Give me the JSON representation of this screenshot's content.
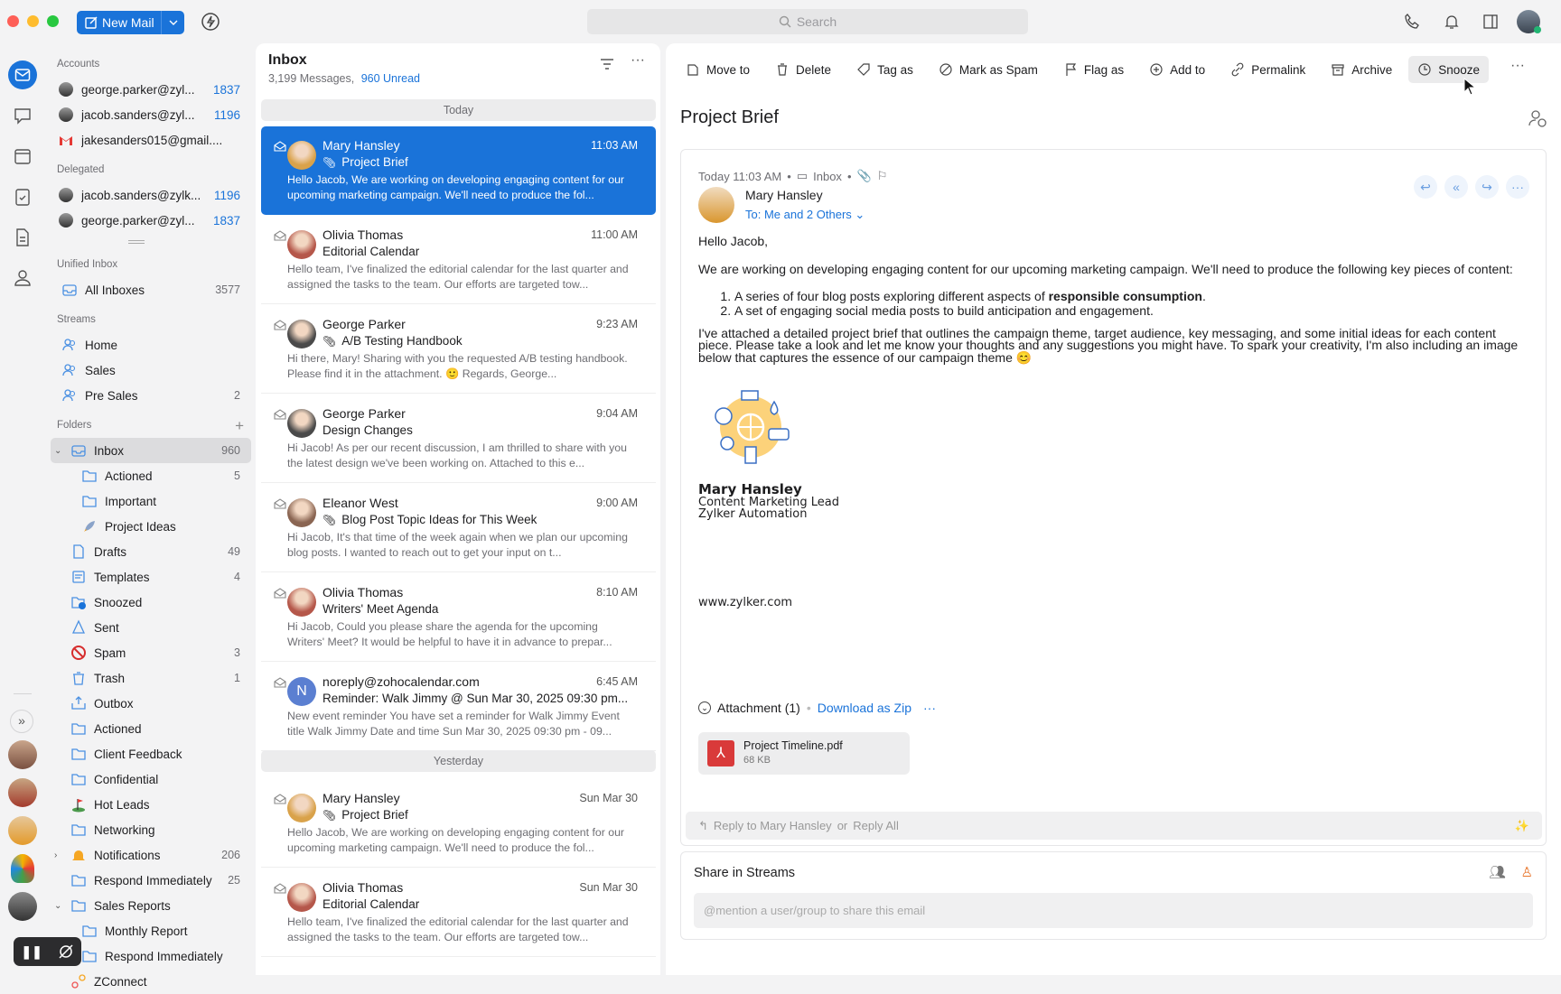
{
  "colors": {
    "accent": "#1a73d9",
    "selected_bg": "#1a73d9",
    "online": "#22b573",
    "spam": "#d62d2d",
    "pdf": "#d93a3a"
  },
  "topbar": {
    "new_mail": "New Mail",
    "search_placeholder": "Search",
    "icons": [
      "phone-icon",
      "bell-icon",
      "panel-icon",
      "profile-avatar"
    ]
  },
  "rail": {
    "icons": [
      "mail-icon",
      "chat-icon",
      "calendar-icon",
      "tasks-icon",
      "notes-icon",
      "contacts-icon"
    ],
    "expand": "»"
  },
  "sidebar": {
    "accounts_label": "Accounts",
    "accounts": [
      {
        "label": "george.parker@zyl...",
        "count": "1837"
      },
      {
        "label": "jacob.sanders@zyl...",
        "count": "1196"
      },
      {
        "label": "jakesanders015@gmail....",
        "count": ""
      }
    ],
    "delegated_label": "Delegated",
    "delegated": [
      {
        "label": "jacob.sanders@zylk...",
        "count": "1196"
      },
      {
        "label": "george.parker@zyl...",
        "count": "1837"
      }
    ],
    "unified_label": "Unified Inbox",
    "unified": [
      {
        "label": "All Inboxes",
        "count": "3577"
      }
    ],
    "streams_label": "Streams",
    "streams": [
      {
        "label": "Home",
        "count": ""
      },
      {
        "label": "Sales",
        "count": ""
      },
      {
        "label": "Pre Sales",
        "count": "2"
      }
    ],
    "folders_label": "Folders",
    "folders": [
      {
        "label": "Inbox",
        "count": "960",
        "icon": "inbox",
        "level": 0,
        "chev": "down",
        "sel": true
      },
      {
        "label": "Actioned",
        "count": "5",
        "icon": "folder",
        "level": 1
      },
      {
        "label": "Important",
        "count": "",
        "icon": "folder",
        "level": 1
      },
      {
        "label": "Project Ideas",
        "count": "",
        "icon": "rocket",
        "level": 1
      },
      {
        "label": "Drafts",
        "count": "49",
        "icon": "draft",
        "level": 0
      },
      {
        "label": "Templates",
        "count": "4",
        "icon": "template",
        "level": 0
      },
      {
        "label": "Snoozed",
        "count": "",
        "icon": "snooze",
        "level": 0
      },
      {
        "label": "Sent",
        "count": "",
        "icon": "sent",
        "level": 0
      },
      {
        "label": "Spam",
        "count": "3",
        "icon": "spam",
        "level": 0
      },
      {
        "label": "Trash",
        "count": "1",
        "icon": "trash",
        "level": 0
      },
      {
        "label": "Outbox",
        "count": "",
        "icon": "outbox",
        "level": 0
      },
      {
        "label": "Actioned",
        "count": "",
        "icon": "folder",
        "level": 0
      },
      {
        "label": "Client Feedback",
        "count": "",
        "icon": "folder",
        "level": 0
      },
      {
        "label": "Confidential",
        "count": "",
        "icon": "folder",
        "level": 0
      },
      {
        "label": "Hot Leads",
        "count": "",
        "icon": "flag",
        "level": 0
      },
      {
        "label": "Networking",
        "count": "",
        "icon": "folder",
        "level": 0
      },
      {
        "label": "Notifications",
        "count": "206",
        "icon": "bell",
        "level": 0,
        "chev": "right"
      },
      {
        "label": "Respond Immediately",
        "count": "25",
        "icon": "folder",
        "level": 0
      },
      {
        "label": "Sales Reports",
        "count": "",
        "icon": "folder",
        "level": 0,
        "chev": "down"
      },
      {
        "label": "Monthly Report",
        "count": "",
        "icon": "folder",
        "level": 1
      },
      {
        "label": "Respond Immediately",
        "count": "",
        "icon": "folder",
        "level": 1
      },
      {
        "label": "ZConnect",
        "count": "",
        "icon": "zconnect",
        "level": 0
      }
    ]
  },
  "list": {
    "title": "Inbox",
    "messages": "3,199 Messages,",
    "unread": "960 Unread",
    "groups": [
      {
        "label": "Today"
      },
      {
        "label": "Yesterday"
      }
    ],
    "items": [
      {
        "from": "Mary Hansley",
        "time": "11:03 AM",
        "subject": "Project Brief",
        "attach": true,
        "preview": "Hello Jacob, We are working on developing engaging content for our upcoming marketing campaign. We'll need to produce the fol...",
        "avatar": "#d9a24a",
        "selected": true
      },
      {
        "from": "Olivia Thomas",
        "time": "11:00 AM",
        "subject": "Editorial Calendar",
        "attach": false,
        "preview": "Hello team, I've finalized the editorial calendar for the last quarter and assigned the tasks to the team. Our efforts are targeted tow...",
        "avatar": "#b5574a"
      },
      {
        "from": "George Parker",
        "time": "9:23 AM",
        "subject": "A/B Testing Handbook",
        "attach": true,
        "preview": "Hi there, Mary! Sharing with you the requested A/B testing handbook. Please find it in the attachment. 🙂 Regards, George...",
        "avatar": "#4a4a4a"
      },
      {
        "from": "George Parker",
        "time": "9:04 AM",
        "subject": "Design Changes",
        "attach": false,
        "preview": "Hi Jacob! As per our recent discussion, I am thrilled to share with you the latest design we've been working on. Attached to this e...",
        "avatar": "#4a4a4a"
      },
      {
        "from": "Eleanor West",
        "time": "9:00 AM",
        "subject": "Blog Post Topic Ideas for This Week",
        "attach": true,
        "preview": "Hi Jacob, It's that time of the week again when we plan our upcoming blog posts. I wanted to reach out to get your input on t...",
        "avatar": "#8a6552"
      },
      {
        "from": "Olivia Thomas",
        "time": "8:10 AM",
        "subject": "Writers' Meet Agenda",
        "attach": false,
        "preview": "Hi Jacob, Could you please share the agenda for the upcoming Writers' Meet? It would be helpful to have it in advance to prepar...",
        "avatar": "#b5574a"
      },
      {
        "from": "noreply@zohocalendar.com",
        "time": "6:45 AM",
        "subject": "Reminder: Walk Jimmy @ Sun Mar 30, 2025 09:30 pm...",
        "attach": false,
        "preview": "New event reminder You have set a reminder for Walk Jimmy Event title Walk Jimmy Date and time Sun Mar 30, 2025 09:30 pm - 09...",
        "avatar": "#5b7fd1",
        "initial": "N"
      },
      {
        "from": "Mary Hansley",
        "time": "Sun Mar 30",
        "subject": "Project Brief",
        "attach": true,
        "preview": "Hello Jacob, We are working on developing engaging content for our upcoming marketing campaign. We'll need to produce the fol...",
        "avatar": "#d9a24a"
      },
      {
        "from": "Olivia Thomas",
        "time": "Sun Mar 30",
        "subject": "Editorial Calendar",
        "attach": false,
        "preview": "Hello team, I've finalized the editorial calendar for the last quarter and assigned the tasks to the team. Our efforts are targeted tow...",
        "avatar": "#b5574a"
      }
    ]
  },
  "toolbar": [
    {
      "label": "Move to",
      "icon": "folder"
    },
    {
      "label": "Delete",
      "icon": "trash"
    },
    {
      "label": "Tag as",
      "icon": "tag"
    },
    {
      "label": "Mark as Spam",
      "icon": "spam"
    },
    {
      "label": "Flag as",
      "icon": "flag"
    },
    {
      "label": "Add to",
      "icon": "plus"
    },
    {
      "label": "Permalink",
      "icon": "link"
    },
    {
      "label": "Archive",
      "icon": "archive"
    },
    {
      "label": "Snooze",
      "icon": "clock",
      "hover": true
    }
  ],
  "mail": {
    "subject": "Project Brief",
    "date": "Today 11:03 AM",
    "folder": "Inbox",
    "sender": "Mary Hansley",
    "to": "To: Me and 2 Others",
    "greeting": "Hello Jacob,",
    "p1": "We are working on developing engaging content for our upcoming marketing campaign. We'll need to produce the following key pieces of content:",
    "li1_pre": "A series of four blog posts exploring different aspects of ",
    "li1_bold": "responsible consumption",
    "li1_post": ".",
    "li2": "A set of engaging social media posts to build anticipation and engagement.",
    "p2": "I've attached a detailed project brief that outlines the campaign theme, target audience, key messaging, and some initial ideas for each content piece. Please take a look and let me know your thoughts and any suggestions you might have. To spark your creativity, I'm also including an image below that captures the essence of our campaign theme 😊",
    "sig_name": "Mary Hansley",
    "sig_title": "Content Marketing Lead",
    "sig_company": "Zylker Automation",
    "website": "www.zylker.com",
    "attachment_label": "Attachment (1)",
    "download_zip": "Download as Zip",
    "file_name": "Project Timeline.pdf",
    "file_size": "68 KB",
    "reply_to": "Reply to Mary Hansley",
    "or": "or",
    "reply_all": "Reply All"
  },
  "share": {
    "title": "Share in Streams",
    "placeholder": "@mention a user/group to share this email"
  }
}
